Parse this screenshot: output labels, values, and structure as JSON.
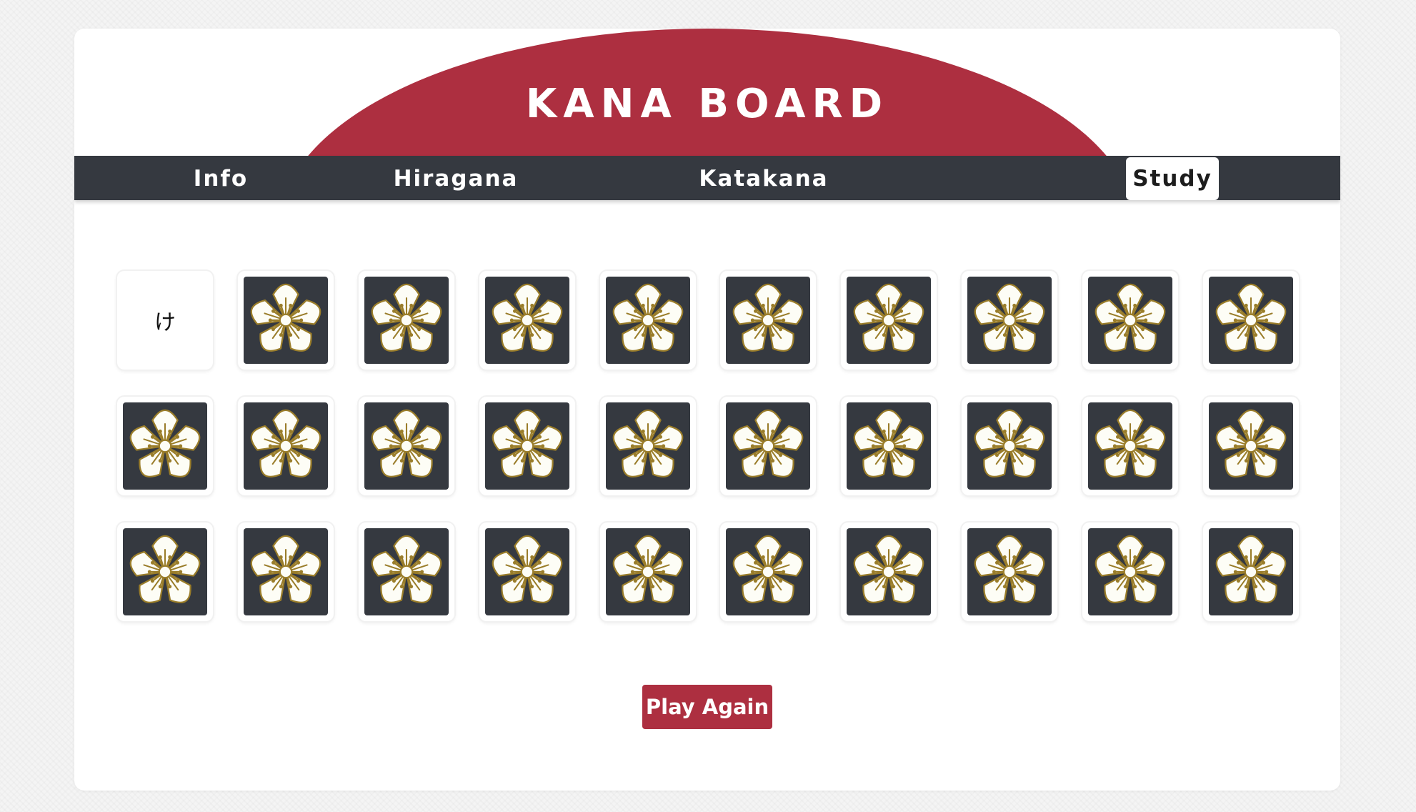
{
  "header": {
    "title": "KANA BOARD"
  },
  "nav": {
    "items": [
      {
        "label": "Info",
        "active": false
      },
      {
        "label": "Hiragana",
        "active": false
      },
      {
        "label": "Katakana",
        "active": false
      },
      {
        "label": "Study",
        "active": true
      }
    ]
  },
  "game": {
    "columns": 10,
    "rows": 3,
    "card_back_icon": "plum-blossom-icon",
    "cards": [
      {
        "face_up": true,
        "kana": "け"
      },
      {
        "face_up": false,
        "kana": ""
      },
      {
        "face_up": false,
        "kana": ""
      },
      {
        "face_up": false,
        "kana": ""
      },
      {
        "face_up": false,
        "kana": ""
      },
      {
        "face_up": false,
        "kana": ""
      },
      {
        "face_up": false,
        "kana": ""
      },
      {
        "face_up": false,
        "kana": ""
      },
      {
        "face_up": false,
        "kana": ""
      },
      {
        "face_up": false,
        "kana": ""
      },
      {
        "face_up": false,
        "kana": ""
      },
      {
        "face_up": false,
        "kana": ""
      },
      {
        "face_up": false,
        "kana": ""
      },
      {
        "face_up": false,
        "kana": ""
      },
      {
        "face_up": false,
        "kana": ""
      },
      {
        "face_up": false,
        "kana": ""
      },
      {
        "face_up": false,
        "kana": ""
      },
      {
        "face_up": false,
        "kana": ""
      },
      {
        "face_up": false,
        "kana": ""
      },
      {
        "face_up": false,
        "kana": ""
      },
      {
        "face_up": false,
        "kana": ""
      },
      {
        "face_up": false,
        "kana": ""
      },
      {
        "face_up": false,
        "kana": ""
      },
      {
        "face_up": false,
        "kana": ""
      },
      {
        "face_up": false,
        "kana": ""
      },
      {
        "face_up": false,
        "kana": ""
      },
      {
        "face_up": false,
        "kana": ""
      },
      {
        "face_up": false,
        "kana": ""
      },
      {
        "face_up": false,
        "kana": ""
      },
      {
        "face_up": false,
        "kana": ""
      }
    ],
    "play_again_label": "Play Again"
  },
  "colors": {
    "accent_red": "#ad2f40",
    "nav_dark": "#353940",
    "card_back": "#353940",
    "blossom_fill": "#fdfdf6",
    "blossom_outline": "#9a7d2a"
  }
}
